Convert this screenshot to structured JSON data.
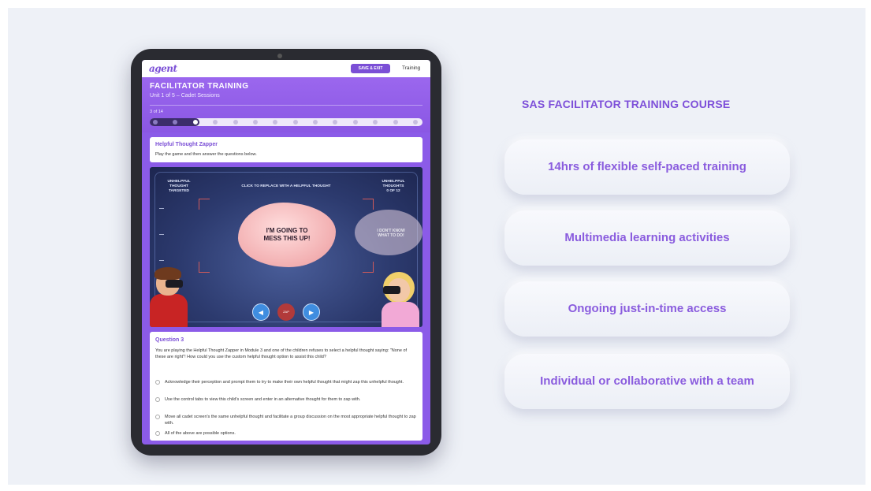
{
  "app": {
    "logo_text": "agent",
    "save_exit_label": "SAVE & EXIT",
    "tab_label": "Training"
  },
  "header": {
    "title": "FACILITATOR TRAINING",
    "subtitle": "Unit 1 of 5 – Cadet Sessions",
    "page_counter": "3 of 14",
    "progress": {
      "current": 3,
      "total": 14
    }
  },
  "activity": {
    "title": "Helpful Thought Zapper",
    "instruction": "Play the game and then answer the questions below."
  },
  "game": {
    "hud_left": "UNHELPFUL\nTHOUGHT\nTARGETED",
    "hud_center": "CLICK TO REPLACE WITH A HELPFUL THOUGHT",
    "hud_right": "UNHELPFUL\nTHOUGHTS\n0 OF 12",
    "main_thought": "I'M GOING TO\nMESS THIS UP!",
    "side_thought": "I DON'T KNOW\nWHAT TO DO!",
    "prev_icon": "◀",
    "next_icon": "▶",
    "zap_label": "ZAP"
  },
  "question": {
    "title": "Question 3",
    "text": "You are playing the Helpful Thought Zapper in Module 3 and one of the children refuses to select a helpful thought saying: \"None of these are right\"! How could you use the custom helpful thought option to assist this child?",
    "options": [
      "Acknowledge their perception and prompt them to try to make their own helpful thought that might zap this unhelpful thought.",
      "Use the control tabs to view this child's screen and enter in an alternative thought for them to zap with.",
      "Move all cadet screen's the same unhelpful thought and facilitate a group discussion on the most appropriate helpful thought to zap with.",
      "All of the above are possible options."
    ]
  },
  "course": {
    "title": "SAS FACILITATOR TRAINING COURSE",
    "features": [
      "14hrs of flexible self-paced training",
      "Multimedia learning activities",
      "Ongoing just-in-time access",
      "Individual or collaborative with a team"
    ]
  },
  "colors": {
    "accent": "#8b5be8",
    "feature_text": "#8a5cde",
    "background": "#eef1f7"
  }
}
